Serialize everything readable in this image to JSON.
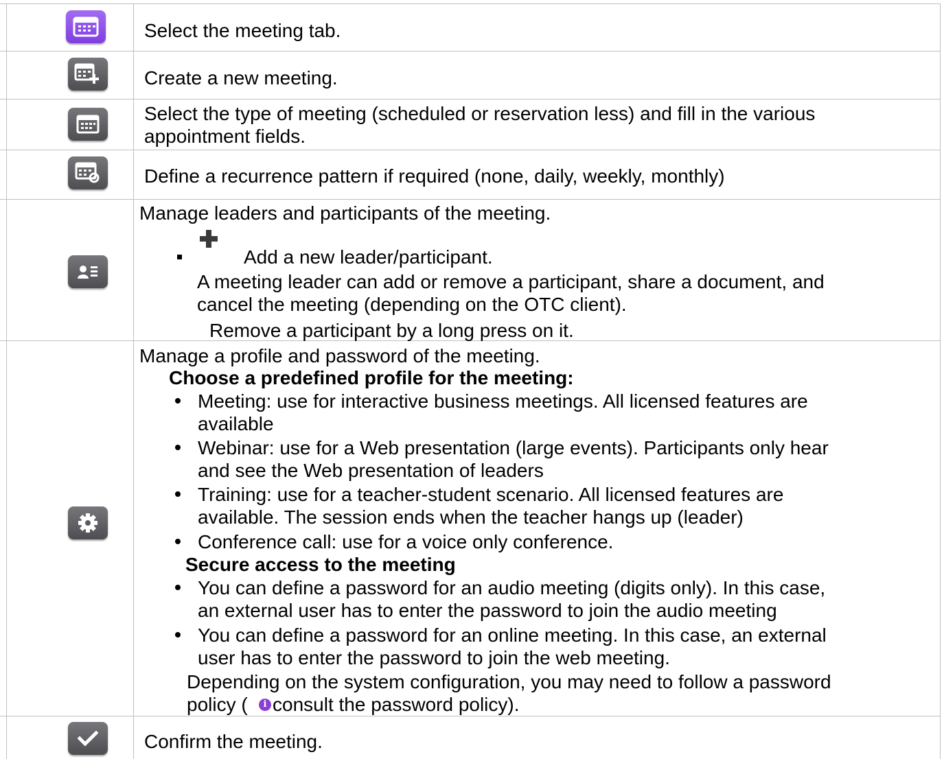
{
  "rows": [
    {
      "icon": "meeting-tab-icon",
      "text": "Select the meeting tab."
    },
    {
      "icon": "new-meeting-icon",
      "text": "Create a new meeting."
    },
    {
      "icon": "meeting-type-icon",
      "lines": [
        "Select the type of meeting (scheduled or reservation less) and fill in the various",
        "appointment fields."
      ]
    },
    {
      "icon": "recurrence-icon",
      "text": "Define a recurrence pattern if required (none, daily, weekly, monthly)"
    },
    {
      "icon": "participants-icon",
      "title": "Manage leaders and participants of the meeting.",
      "add_label": "Add a new leader/participant.",
      "leader_lines": [
        "A meeting leader can add or remove a participant, share a document, and",
        "cancel the meeting (depending on the OTC client)."
      ],
      "remove_text": "Remove a participant by a long press on it."
    },
    {
      "icon": "settings-gear-icon",
      "title": "Manage a profile and password of the meeting.",
      "profile_heading": "Choose a predefined profile for the meeting:",
      "profiles": [
        [
          "Meeting: use for interactive business meetings. All licensed features are",
          "available"
        ],
        [
          "Webinar: use for a Web presentation (large events). Participants only hear",
          "and see the Web presentation of leaders"
        ],
        [
          "Training: use for a teacher-student scenario. All licensed features are",
          "available. The session ends when the teacher hangs up (leader)"
        ],
        [
          "Conference call: use for a voice only conference."
        ]
      ],
      "secure_heading": "Secure access to the meeting",
      "secure": [
        [
          "You can define a password for an audio meeting (digits only). In this case,",
          "an external user has to enter the password to join the audio meeting"
        ],
        [
          "You can define a password for an online meeting. In this case, an external",
          "user has to enter the password to join the web meeting."
        ]
      ],
      "policy_line1": "Depending on the system configuration, you may need to follow a password",
      "policy_pre": "policy (",
      "policy_post": " consult the password policy)."
    },
    {
      "icon": "confirm-check-icon",
      "text": "Confirm the meeting."
    }
  ],
  "colors": {
    "meeting_tab": "#8b3fd6",
    "icon_gray": "#5a5a5e",
    "info": "#8b3fd6"
  }
}
